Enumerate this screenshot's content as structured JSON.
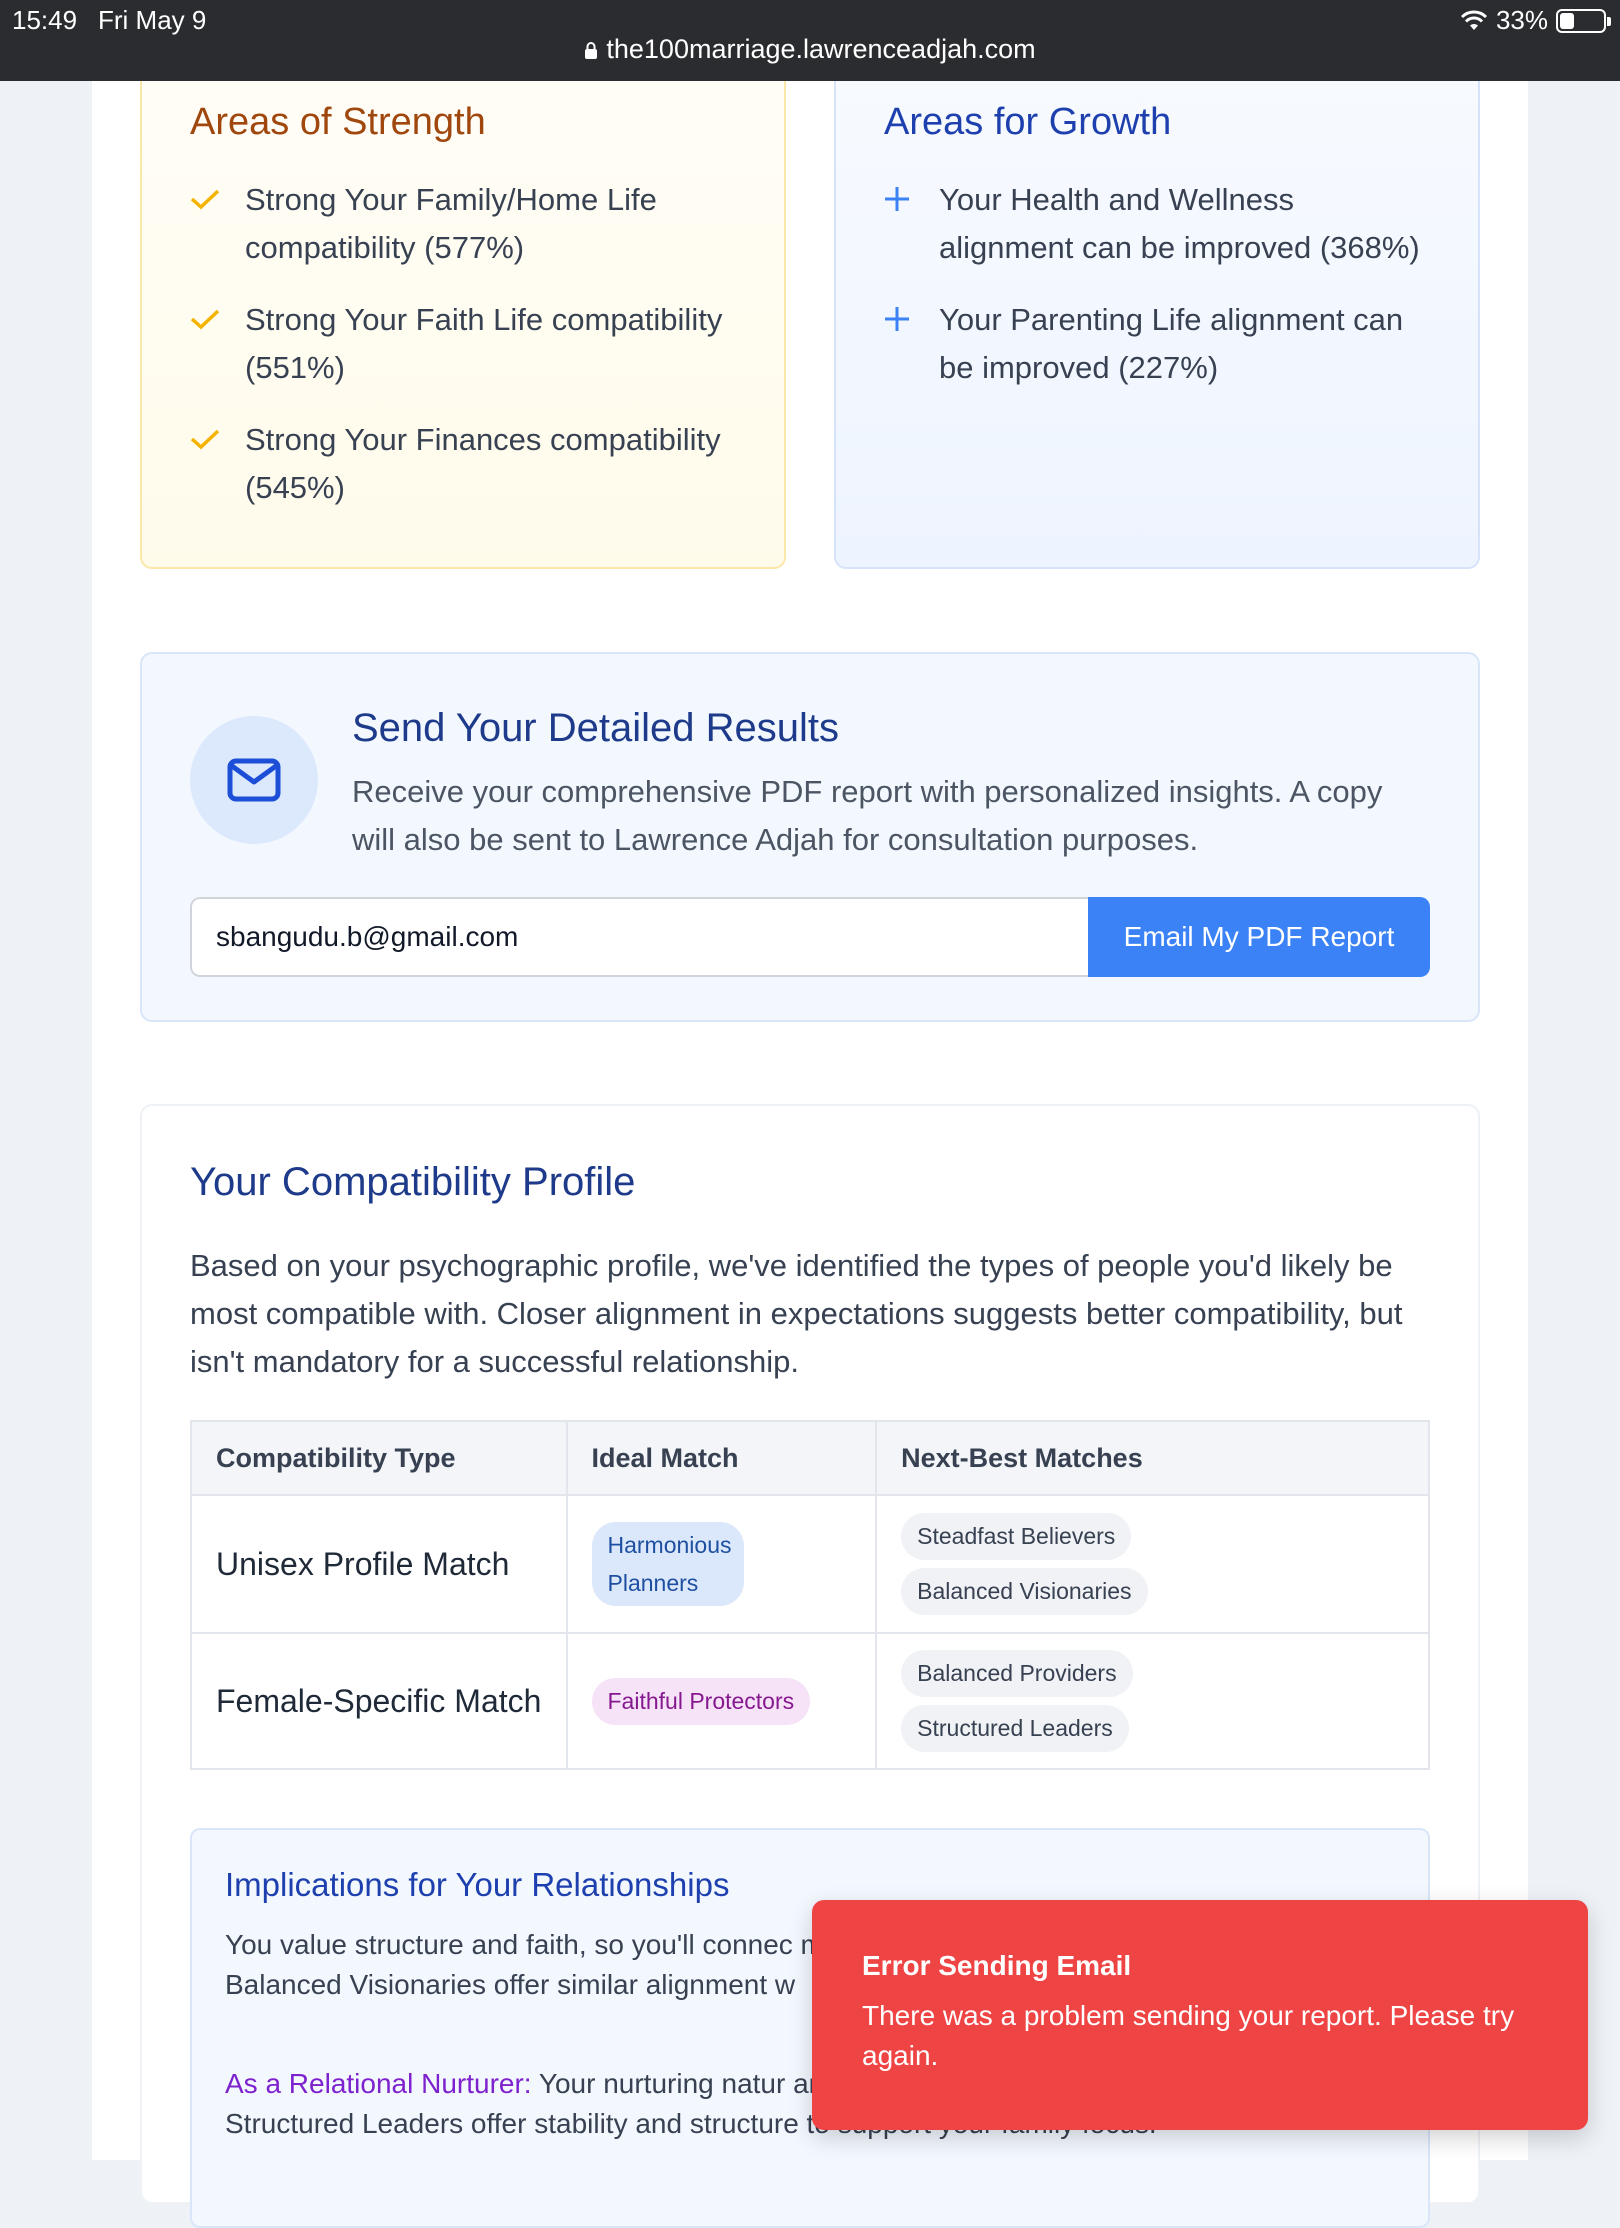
{
  "status_bar": {
    "time": "15:49",
    "date": "Fri May 9",
    "battery": "33%",
    "battery_level": 0.33
  },
  "browser": {
    "url": "the100marriage.lawrenceadjah.com"
  },
  "strength": {
    "title": "Areas of Strength",
    "items": [
      {
        "text": "Strong Your Family/Home Life compatibility (577%)"
      },
      {
        "text": "Strong Your Faith Life compatibility (551%)"
      },
      {
        "text": "Strong Your Finances compatibility (545%)"
      }
    ]
  },
  "growth": {
    "title": "Areas for Growth",
    "items": [
      {
        "text": "Your Health and Wellness alignment can be improved (368%)"
      },
      {
        "text": "Your Parenting Life alignment can be improved (227%)"
      }
    ]
  },
  "email_section": {
    "title": "Send Your Detailed Results",
    "description": "Receive your comprehensive PDF report with personalized insights. A copy will also be sent to Lawrence Adjah for consultation purposes.",
    "email_value": "sbangudu.b@gmail.com",
    "button_label": "Email My PDF Report"
  },
  "profile": {
    "title": "Your Compatibility Profile",
    "description": "Based on your psychographic profile, we've identified the types of people you'd likely be most compatible with. Closer alignment in expectations suggests better compatibility, but isn't mandatory for a successful relationship.",
    "table": {
      "headers": [
        "Compatibility Type",
        "Ideal Match",
        "Next-Best Matches"
      ],
      "rows": [
        {
          "type": "Unisex Profile Match",
          "ideal": "Harmonious Planners",
          "next": [
            "Steadfast Believers",
            "Balanced Visionaries"
          ]
        },
        {
          "type": "Female-Specific Match",
          "ideal": "Faithful Protectors",
          "next": [
            "Balanced Providers",
            "Structured Leaders"
          ]
        }
      ]
    },
    "implications": {
      "title": "Implications for Your Relationships",
      "paragraph1": "You value structure and faith, so you'll connec mindset. Harmonious Planners are your ideal m Balanced Visionaries offer similar alignment w",
      "label": "As a Relational Nurturer:",
      "paragraph2": " Your nurturing natur and faith. A Faithful Protector's leadership alig Structured Leaders offer stability and structure to support your family focus."
    }
  },
  "toast": {
    "title": "Error Sending Email",
    "message": "There was a problem sending your report. Please try again."
  },
  "colors": {
    "primary": "#3b82f6",
    "error": "#ef4444",
    "heading_blue": "#1e3a8a",
    "strength_brown": "#a0470e",
    "check_gold": "#f5b301"
  }
}
